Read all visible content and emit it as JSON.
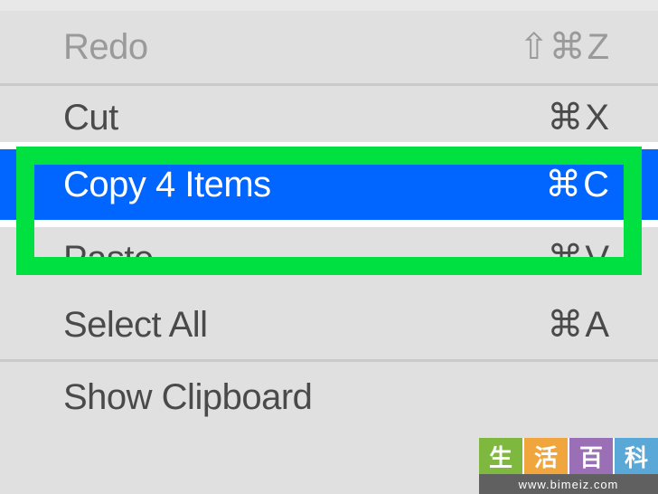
{
  "menu": {
    "redo": {
      "label": "Redo",
      "shortcut_prefix": "⇧⌘",
      "shortcut_key": "Z"
    },
    "cut": {
      "label": "Cut",
      "shortcut_prefix": "⌘",
      "shortcut_key": "X"
    },
    "copy": {
      "label": "Copy 4 Items",
      "shortcut_prefix": "⌘",
      "shortcut_key": "C"
    },
    "paste": {
      "label": "Paste",
      "shortcut_prefix": "⌘",
      "shortcut_key": "V"
    },
    "select_all": {
      "label": "Select All",
      "shortcut_prefix": "⌘",
      "shortcut_key": "A"
    },
    "show_clip": {
      "label": "Show Clipboard"
    }
  },
  "watermark": {
    "chars": {
      "c1": "生",
      "c2": "活",
      "c3": "百",
      "c4": "科"
    },
    "url": "www.bimeiz.com"
  }
}
